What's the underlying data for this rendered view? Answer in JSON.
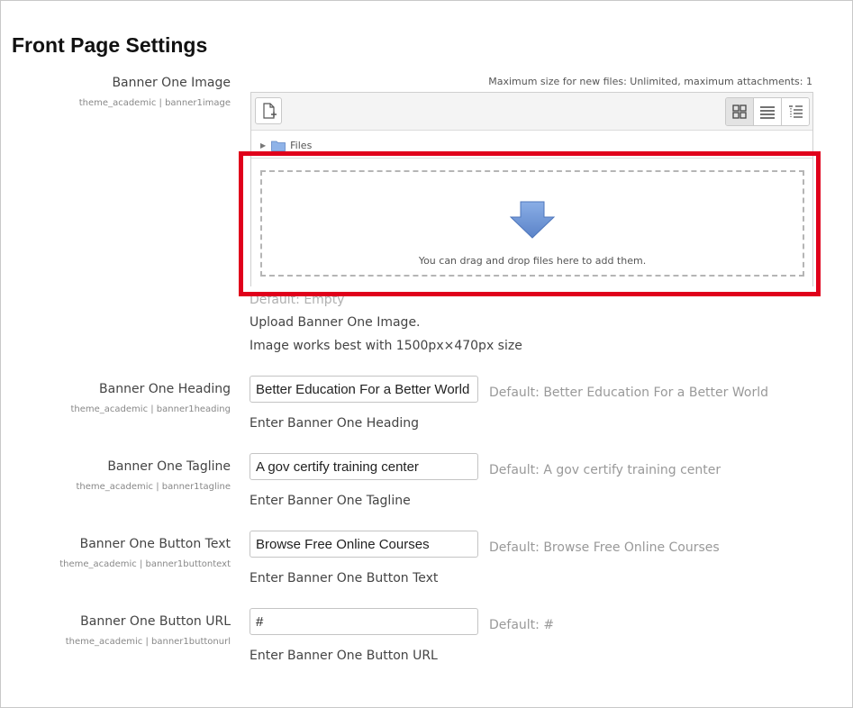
{
  "page": {
    "title": "Front Page Settings"
  },
  "banner_image": {
    "label": "Banner One Image",
    "setting_id": "theme_academic | banner1image",
    "max_size_note": "Maximum size for new files: Unlimited, maximum attachments: 1",
    "tree_root": "Files",
    "drop_text": "You can drag and drop files here to add them.",
    "default_text": "Default: Empty",
    "description_1": "Upload Banner One Image.",
    "description_2": "Image works best with 1500px×470px size",
    "icons": {
      "add_file": "file-add-icon",
      "view_icons": "grid-view-icon",
      "view_list": "list-view-icon",
      "view_tree": "tree-view-icon",
      "folder": "folder-icon",
      "drop_arrow": "down-arrow-icon"
    }
  },
  "fields": [
    {
      "label": "Banner One Heading",
      "setting_id": "theme_academic | banner1heading",
      "value": "Better Education For a Better World",
      "default_text": "Default: Better Education For a Better World",
      "description": "Enter Banner One Heading"
    },
    {
      "label": "Banner One Tagline",
      "setting_id": "theme_academic | banner1tagline",
      "value": "A gov certify training center",
      "default_text": "Default: A gov certify training center",
      "description": "Enter Banner One Tagline"
    },
    {
      "label": "Banner One Button Text",
      "setting_id": "theme_academic | banner1buttontext",
      "value": "Browse Free Online Courses",
      "default_text": "Default: Browse Free Online Courses",
      "description": "Enter Banner One Button Text"
    },
    {
      "label": "Banner One Button URL",
      "setting_id": "theme_academic | banner1buttonurl",
      "value": "#",
      "default_text": "Default: #",
      "description": "Enter Banner One Button URL"
    }
  ],
  "colors": {
    "highlight_border": "#e0001b",
    "arrow_fill": "#6f96d6"
  }
}
